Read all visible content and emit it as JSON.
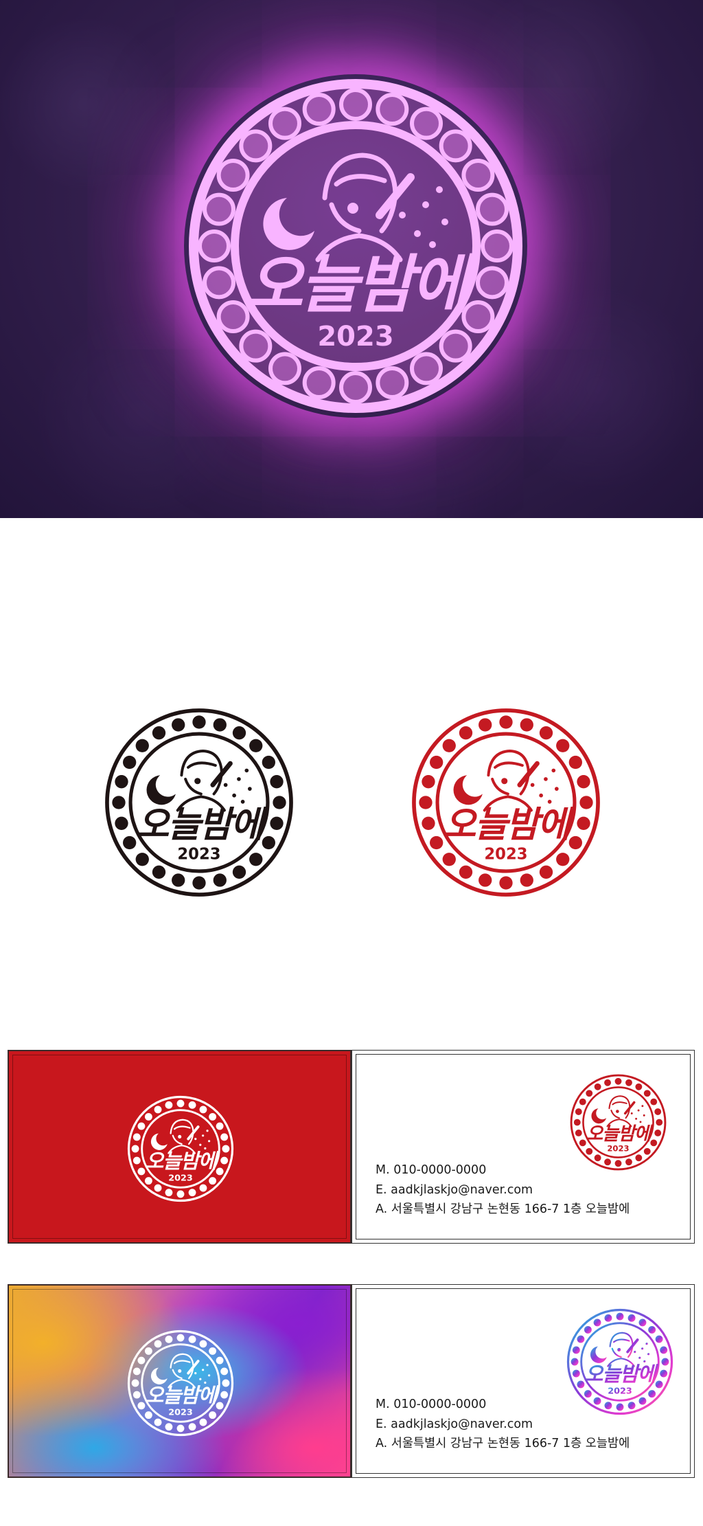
{
  "brand": {
    "name": "오늘밤에",
    "year": "2023"
  },
  "colors": {
    "black_logo": "#1e1414",
    "red_logo": "#c41a22",
    "red_card": "#c8171d",
    "neon": "#f8b4ff",
    "neon_glow": "#ff4dff"
  },
  "card": {
    "phone": "M. 010-0000-0000",
    "email": "E. aadkjlaskjo@naver.com",
    "address": "A. 서울특별시 강남구 논현동 166-7 1층 오늘밤에"
  }
}
